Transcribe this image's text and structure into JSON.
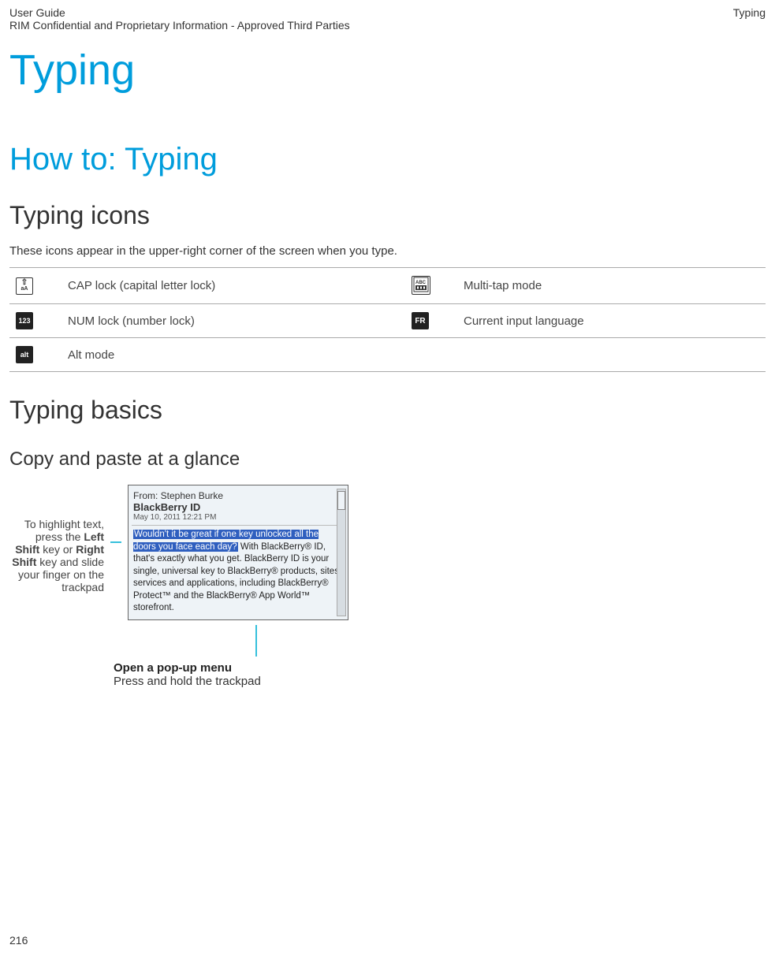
{
  "header": {
    "left_line1": "User Guide",
    "left_line2": "RIM Confidential and Proprietary Information - Approved Third Parties",
    "right": "Typing"
  },
  "title": "Typing",
  "section1": {
    "heading": "How to: Typing",
    "sub_icons": {
      "heading": "Typing icons",
      "intro": "These icons appear in the upper-right corner of the screen when you type.",
      "rows": [
        {
          "left_label": "CAP lock (capital letter lock)",
          "right_label": "Multi-tap mode"
        },
        {
          "left_label": "NUM lock (number lock)",
          "right_label": "Current input language"
        },
        {
          "left_label": "Alt mode",
          "right_label": ""
        }
      ]
    },
    "sub_basics": {
      "heading": "Typing basics",
      "copy_heading": "Copy and paste at a glance",
      "callout_left_pre": "To highlight text, press the ",
      "callout_left_b1": "Left Shift",
      "callout_left_mid": " key or ",
      "callout_left_b2": "Right Shift",
      "callout_left_post": " key and slide your finger on the trackpad",
      "phone": {
        "from": "From: Stephen Burke",
        "subject": "BlackBerry ID",
        "date": "May 10, 2011 12:21 PM",
        "hl": "Wouldn't it be great if one key unlocked all the doors you face each day?",
        "after_hl": " With BlackBerry® ID, that's exactly what you get. BlackBerry ID is your single, universal key to BlackBerry® products, sites, services and applications, including BlackBerry® Protect™ and the BlackBerry® App World™ storefront."
      },
      "popup": {
        "title": "Open a pop-up menu",
        "sub": "Press and hold the trackpad"
      }
    }
  },
  "page_number": "216"
}
